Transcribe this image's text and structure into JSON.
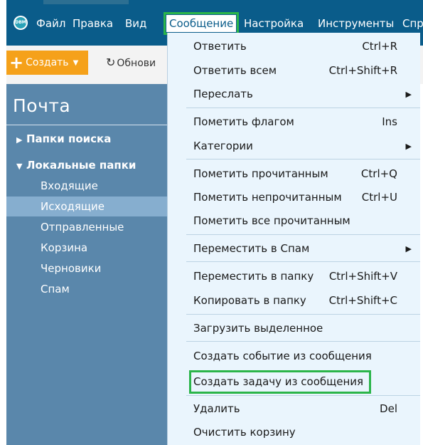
{
  "menubar": {
    "logo_text": "DBM",
    "items": [
      "Файл",
      "Правка",
      "Вид",
      "Сообщение",
      "Настройка",
      "Инструменты",
      "Спр"
    ]
  },
  "toolbar": {
    "create_label": "Создать",
    "refresh_label": "Обнови"
  },
  "sidebar": {
    "title": "Почта",
    "search_folders": "Папки поиска",
    "local_folders": "Локальные папки",
    "items": [
      "Входящие",
      "Исходящие",
      "Отправленные",
      "Корзина",
      "Черновики",
      "Спам"
    ],
    "selected": "Исходящие"
  },
  "dropdown": {
    "items": [
      {
        "label": "Ответить",
        "shortcut": "Ctrl+R"
      },
      {
        "label": "Ответить всем",
        "shortcut": "Ctrl+Shift+R"
      },
      {
        "label": "Переслать",
        "shortcut": ""
      },
      {
        "label": "Пометить флагом",
        "shortcut": "Ins"
      },
      {
        "label": "Категории",
        "shortcut": ""
      },
      {
        "label": "Пометить прочитанным",
        "shortcut": "Ctrl+Q"
      },
      {
        "label": "Пометить непрочитанным",
        "shortcut": "Ctrl+U"
      },
      {
        "label": "Пометить все прочитанным",
        "shortcut": ""
      },
      {
        "label": "Переместить в Спам",
        "shortcut": ""
      },
      {
        "label": "Переместить в папку",
        "shortcut": "Ctrl+Shift+V"
      },
      {
        "label": "Копировать в папку",
        "shortcut": "Ctrl+Shift+C"
      },
      {
        "label": "Загрузить выделенное",
        "shortcut": ""
      },
      {
        "label": "Создать событие из сообщения",
        "shortcut": ""
      },
      {
        "label": "Создать задачу из сообщения",
        "shortcut": ""
      },
      {
        "label": "Удалить",
        "shortcut": "Del"
      },
      {
        "label": "Очистить корзину",
        "shortcut": ""
      }
    ]
  },
  "colors": {
    "menubar": "#0a5c8a",
    "sidebar": "#5a87ab",
    "selected": "#86aecf",
    "dropdown": "#eaf5fd",
    "highlight": "#2bb54a",
    "create_button": "#f5a11a"
  }
}
